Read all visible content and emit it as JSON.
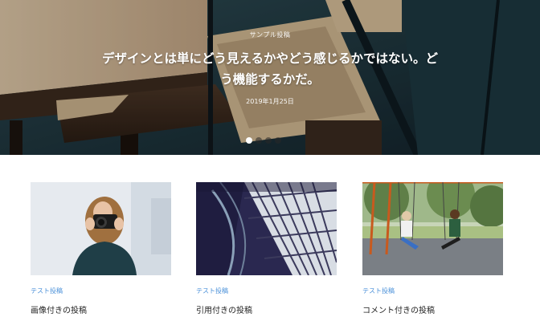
{
  "hero": {
    "category": "サンプル投稿",
    "title": "デザインとは単にどう見えるかやどう感じるかではない。どう機能するかだ。",
    "date": "2019年1月25日",
    "slides": [
      {
        "active": true
      },
      {
        "active": false
      },
      {
        "active": false
      },
      {
        "active": false
      }
    ]
  },
  "posts": [
    {
      "category": "テスト投稿",
      "title": "画像付きの投稿",
      "thumb": "woman-with-camera"
    },
    {
      "category": "テスト投稿",
      "title": "引用付きの投稿",
      "thumb": "architecture-ceiling"
    },
    {
      "category": "テスト投稿",
      "title": "コメント付きの投稿",
      "thumb": "playground-swings"
    }
  ]
}
